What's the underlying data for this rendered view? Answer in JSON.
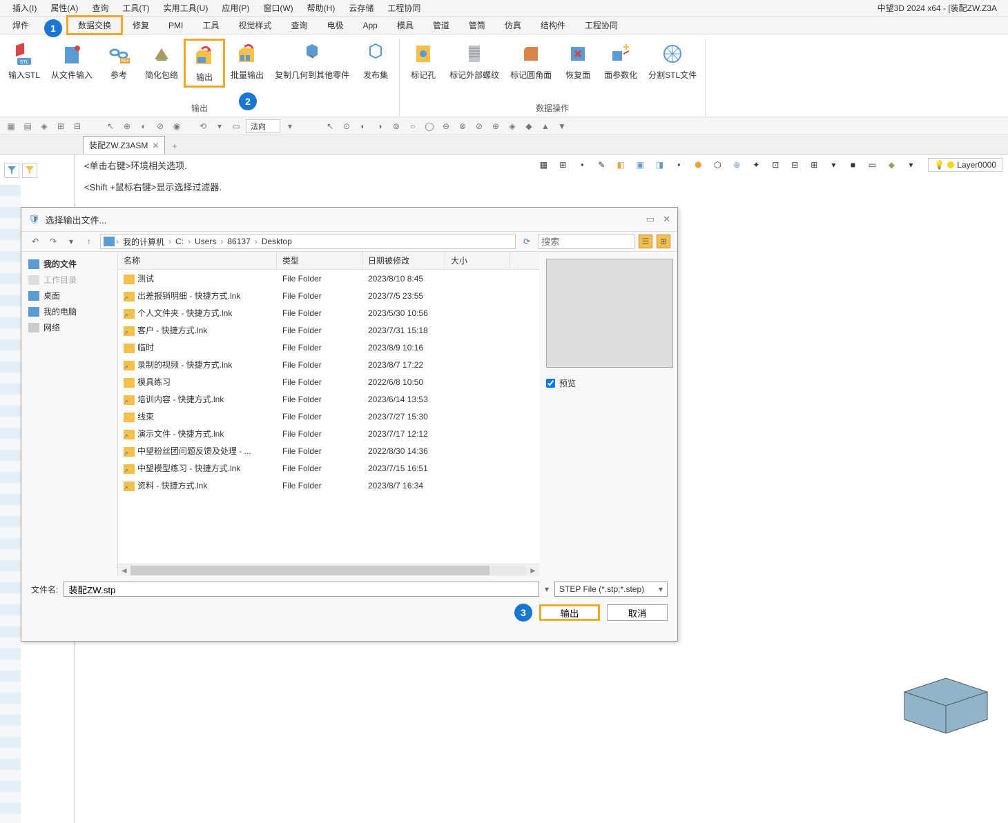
{
  "app_title": "中望3D 2024 x64 - [装配ZW.Z3A",
  "menus": [
    "插入(I)",
    "属性(A)",
    "查询",
    "工具(T)",
    "实用工具(U)",
    "应用(P)",
    "窗口(W)",
    "帮助(H)",
    "云存储",
    "工程协同"
  ],
  "tabs": [
    "焊件",
    "",
    "数据交换",
    "修复",
    "PMI",
    "工具",
    "视觉样式",
    "查询",
    "电极",
    "App",
    "模具",
    "管道",
    "管筒",
    "仿真",
    "结构件",
    "工程协同"
  ],
  "active_tab_index": 2,
  "badges": {
    "one": "1",
    "two": "2",
    "three": "3"
  },
  "ribbon": {
    "group1": {
      "buttons": [
        {
          "label": "输入STL"
        },
        {
          "label": "从文件输入"
        },
        {
          "label": "参考"
        },
        {
          "label": "简化包络"
        },
        {
          "label": "输出",
          "highlight": true
        },
        {
          "label": "批量输出"
        },
        {
          "label": "复制几何到其他零件"
        },
        {
          "label": "发布集"
        }
      ],
      "title": "输出"
    },
    "group2": {
      "buttons": [
        {
          "label": "标记孔"
        },
        {
          "label": "标记外部螺纹"
        },
        {
          "label": "标记圆角面"
        },
        {
          "label": "恢复面"
        },
        {
          "label": "面参数化"
        },
        {
          "label": "分割STL文件"
        }
      ],
      "title": "数据操作"
    }
  },
  "quickbar_combo": "法向",
  "doc_tab": "装配ZW.Z3ASM",
  "hints": [
    "<单击右键>环境相关选项.",
    "<Shift +鼠标右键>显示选择过滤器."
  ],
  "layer": "Layer0000",
  "dialog": {
    "title": "选择输出文件...",
    "breadcrumb": [
      "我的计算机",
      "C:",
      "Users",
      "86137",
      "Desktop"
    ],
    "search_placeholder": "搜索",
    "sidebar": [
      {
        "label": "我的文件",
        "bold": true,
        "color": "#5b9bd5"
      },
      {
        "label": "工作目录",
        "dim": true,
        "color": "#bfbfbf"
      },
      {
        "label": "桌面",
        "color": "#5b9bd5"
      },
      {
        "label": "我的电脑",
        "color": "#5b9bd5"
      },
      {
        "label": "网络",
        "color": "#bfbfbf"
      }
    ],
    "columns": {
      "name": "名称",
      "type": "类型",
      "date": "日期被修改",
      "size": "大小"
    },
    "rows": [
      {
        "name": "测试",
        "type": "File Folder",
        "date": "2023/8/10 8:45",
        "icon": "folder"
      },
      {
        "name": "出差报销明细 - 快捷方式.lnk",
        "type": "File Folder",
        "date": "2023/7/5 23:55",
        "icon": "shortcut"
      },
      {
        "name": "个人文件夹 - 快捷方式.lnk",
        "type": "File Folder",
        "date": "2023/5/30 10:56",
        "icon": "shortcut"
      },
      {
        "name": "客户 - 快捷方式.lnk",
        "type": "File Folder",
        "date": "2023/7/31 15:18",
        "icon": "shortcut"
      },
      {
        "name": "临时",
        "type": "File Folder",
        "date": "2023/8/9 10:16",
        "icon": "folder"
      },
      {
        "name": "录制的视频 - 快捷方式.lnk",
        "type": "File Folder",
        "date": "2023/8/7 17:22",
        "icon": "shortcut"
      },
      {
        "name": "模具练习",
        "type": "File Folder",
        "date": "2022/6/8 10:50",
        "icon": "folder"
      },
      {
        "name": "培训内容 - 快捷方式.lnk",
        "type": "File Folder",
        "date": "2023/6/14 13:53",
        "icon": "shortcut"
      },
      {
        "name": "线束",
        "type": "File Folder",
        "date": "2023/7/27 15:30",
        "icon": "folder"
      },
      {
        "name": "演示文件 - 快捷方式.lnk",
        "type": "File Folder",
        "date": "2023/7/17 12:12",
        "icon": "shortcut"
      },
      {
        "name": "中望粉丝团问题反馈及处理 - ...",
        "type": "File Folder",
        "date": "2022/8/30 14:36",
        "icon": "shortcut"
      },
      {
        "name": "中望模型练习 - 快捷方式.lnk",
        "type": "File Folder",
        "date": "2023/7/15 16:51",
        "icon": "shortcut"
      },
      {
        "name": "资料 - 快捷方式.lnk",
        "type": "File Folder",
        "date": "2023/8/7 16:34",
        "icon": "shortcut"
      }
    ],
    "preview_label": "预览",
    "filename_label": "文件名:",
    "filename_value": "装配ZW.stp",
    "filetype": "STEP File (*.stp;*.step)",
    "export_btn": "输出",
    "cancel_btn": "取消"
  }
}
